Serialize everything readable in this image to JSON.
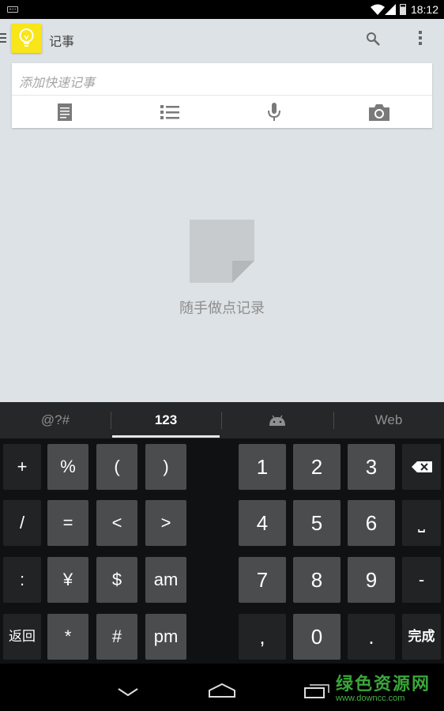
{
  "status_bar": {
    "time": "18:12",
    "icons": [
      "keyboard-icon",
      "wifi-icon",
      "signal-icon",
      "battery-icon"
    ]
  },
  "action_bar": {
    "title": "记事",
    "logo_icon": "lightbulb-icon",
    "actions": [
      "search-icon",
      "overflow-menu-icon"
    ]
  },
  "quick_note": {
    "placeholder": "添加快速记事",
    "buttons": [
      "note-icon",
      "list-icon",
      "microphone-icon",
      "camera-icon"
    ]
  },
  "empty_state": {
    "icon": "note-page-icon",
    "text": "随手做点记录"
  },
  "keyboard": {
    "tabs": [
      "@?#",
      "123",
      "android-icon",
      "Web"
    ],
    "active_tab": "123",
    "keys": {
      "plus": "+",
      "percent": "%",
      "lparen": "(",
      "rparen": ")",
      "one": "1",
      "two": "2",
      "three": "3",
      "slash": "/",
      "equals": "=",
      "lt": "<",
      "gt": ">",
      "four": "4",
      "five": "5",
      "six": "6",
      "space": "⎵",
      "colon": ":",
      "yen": "¥",
      "dollar": "$",
      "am": "am",
      "seven": "7",
      "eight": "8",
      "nine": "9",
      "minus": "-",
      "back": "返回",
      "star": "*",
      "hash": "#",
      "pm": "pm",
      "comma": ",",
      "zero": "0",
      "period": ".",
      "done": "完成"
    }
  },
  "colors": {
    "app_background": "#dde2e6",
    "logo_yellow": "#f8e51a",
    "keyboard_background": "#101112",
    "key_background": "#4b4c4e"
  },
  "watermark": {
    "text": "绿色资源网",
    "url": "www.downcc.com"
  }
}
